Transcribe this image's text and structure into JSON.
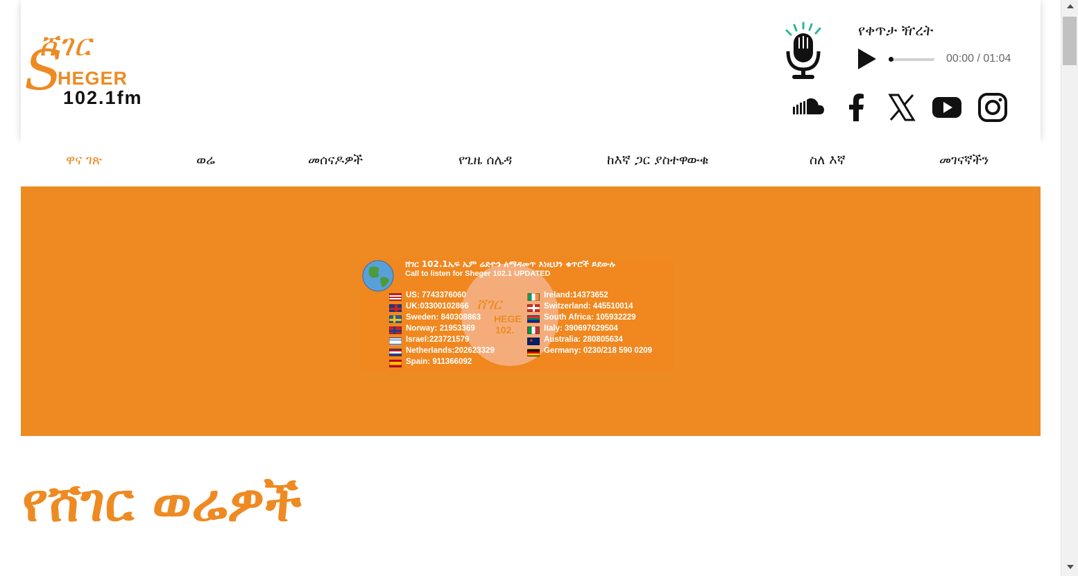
{
  "brand": {
    "logo_amharic": "ሸገር",
    "logo_letter": "S",
    "logo_latin": "HEGER",
    "logo_freq": "102.1fm",
    "accent_color": "#ee8a22"
  },
  "player": {
    "title": "የቀጥታ ዥረት",
    "time": "00:00 / 01:04",
    "progress": 0.0
  },
  "socials": [
    {
      "name": "soundcloud-icon"
    },
    {
      "name": "facebook-icon"
    },
    {
      "name": "x-icon"
    },
    {
      "name": "youtube-icon"
    },
    {
      "name": "instagram-icon"
    }
  ],
  "nav": {
    "items": [
      {
        "label": "ዋና ገጽ",
        "active": true
      },
      {
        "label": "ወሬ"
      },
      {
        "label": "መሰናዶዎች"
      },
      {
        "label": "የጊዜ ሰሌዳ"
      },
      {
        "label": "ከእኛ ጋር ያስተዋውቁ"
      },
      {
        "label": "ስለ እኛ"
      },
      {
        "label": "መገናኛችን"
      }
    ]
  },
  "promo": {
    "heading_amharic": "ሸገር 102.1ኤፍ ኤም ሬድዮን ለማዳመጥ እነዚህን ቁጥሮች ይደውሉ",
    "heading_english": "Call to listen for Sheger 102.1 UPDATED",
    "logo_amharic": "ሸገር",
    "logo_latin": "HEGE",
    "logo_freq": "102.",
    "left_numbers": [
      "US: 7743376060",
      "UK:03300102866",
      "Sweden: 840308863",
      "Norway: 21953369",
      "Israel:223721579",
      "Netherlands:202623329",
      "Spain: 911366092"
    ],
    "right_numbers": [
      "Ireland:14373652",
      "Switzerland: 445510014",
      "South Africa: 105932229",
      "Italy: 390697629504",
      "Australia: 280805634",
      "Germany: 0230/218 590 0209"
    ]
  },
  "section": {
    "title": "የሸገር ወሬዎች"
  }
}
